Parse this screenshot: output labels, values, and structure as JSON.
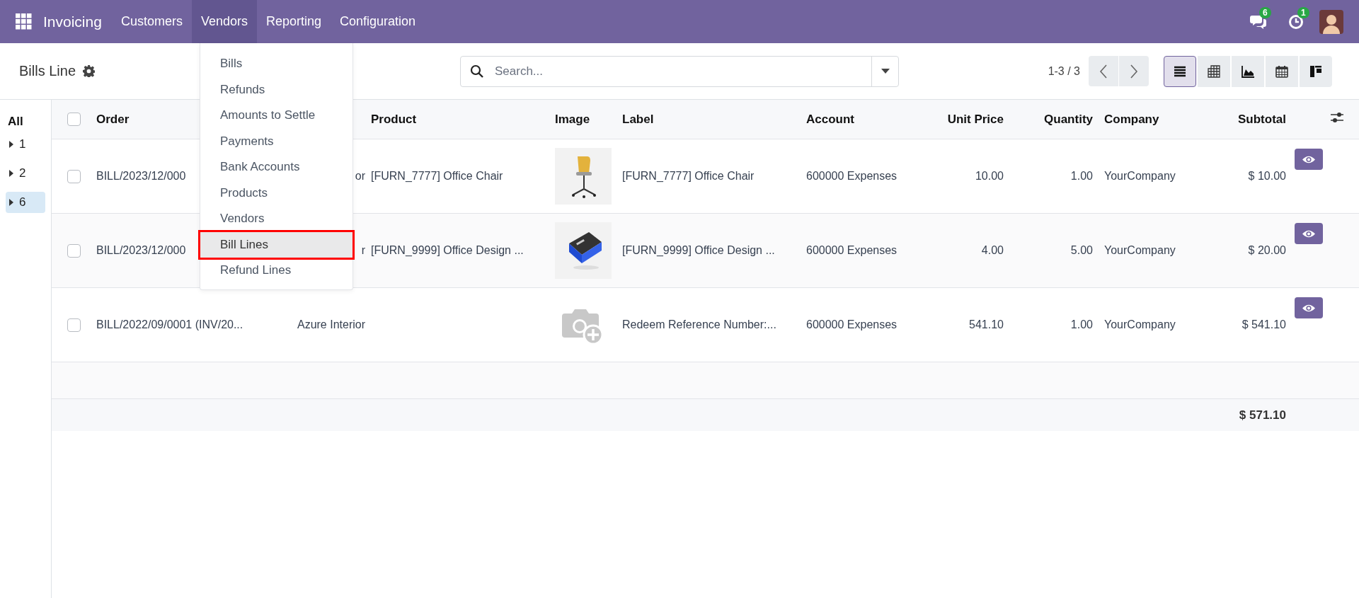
{
  "app": {
    "name": "Invoicing"
  },
  "nav": [
    {
      "label": "Customers",
      "selected": false
    },
    {
      "label": "Vendors",
      "selected": true
    },
    {
      "label": "Reporting",
      "selected": false
    },
    {
      "label": "Configuration",
      "selected": false
    }
  ],
  "systray": {
    "messages_badge": "6",
    "activities_badge": "1"
  },
  "vendors_menu": [
    {
      "label": "Bills",
      "selected": false,
      "marked": false
    },
    {
      "label": "Refunds",
      "selected": false,
      "marked": false
    },
    {
      "label": "Amounts to Settle",
      "selected": false,
      "marked": false
    },
    {
      "label": "Payments",
      "selected": false,
      "marked": false
    },
    {
      "label": "Bank Accounts",
      "selected": false,
      "marked": false
    },
    {
      "label": "Products",
      "selected": false,
      "marked": false
    },
    {
      "label": "Vendors",
      "selected": false,
      "marked": false
    },
    {
      "label": "Bill Lines",
      "selected": true,
      "marked": true
    },
    {
      "label": "Refund Lines",
      "selected": false,
      "marked": false
    }
  ],
  "page_title": "Bills Line",
  "search": {
    "placeholder": "Search..."
  },
  "pager": "1-3 / 3",
  "views": [
    {
      "kind": "list",
      "selected": true
    },
    {
      "kind": "pivot",
      "selected": false
    },
    {
      "kind": "graph",
      "selected": false
    },
    {
      "kind": "calendar",
      "selected": false
    },
    {
      "kind": "kanban",
      "selected": false
    }
  ],
  "sidebar": {
    "title": "All",
    "items": [
      {
        "label": "1",
        "selected": false
      },
      {
        "label": "2",
        "selected": false
      },
      {
        "label": "6",
        "selected": true
      }
    ]
  },
  "table": {
    "header_checked": false,
    "columns": [
      "Order",
      "",
      "Product",
      "Image",
      "Label",
      "Account",
      "Unit Price",
      "Quantity",
      "Company",
      "Subtotal"
    ],
    "rows": [
      {
        "checked": false,
        "cells": [
          "BILL/2023/12/000",
          "or",
          "[FURN_7777] Office Chair",
          {
            "kind": "picture"
          },
          "[FURN_7777] Office Chair",
          "600000 Expenses",
          "10.00",
          "1.00",
          "YourCompany",
          "$ 10.00"
        ]
      },
      {
        "checked": false,
        "cells": [
          "BILL/2023/12/000",
          "r",
          "[FURN_9999] Office Design ...",
          {
            "kind": "picture"
          },
          "[FURN_9999] Office Design ...",
          "600000 Expenses",
          "4.00",
          "5.00",
          "YourCompany",
          "$ 20.00"
        ]
      },
      {
        "checked": false,
        "cells": [
          "BILL/2022/09/0001 (INV/20...",
          "Azure Interior",
          "",
          {
            "kind": "placeholder"
          },
          "Redeem Reference Number:...",
          "600000 Expenses",
          "541.10",
          "1.00",
          "YourCompany",
          "$ 541.10"
        ]
      }
    ],
    "total": "$ 571.10"
  }
}
